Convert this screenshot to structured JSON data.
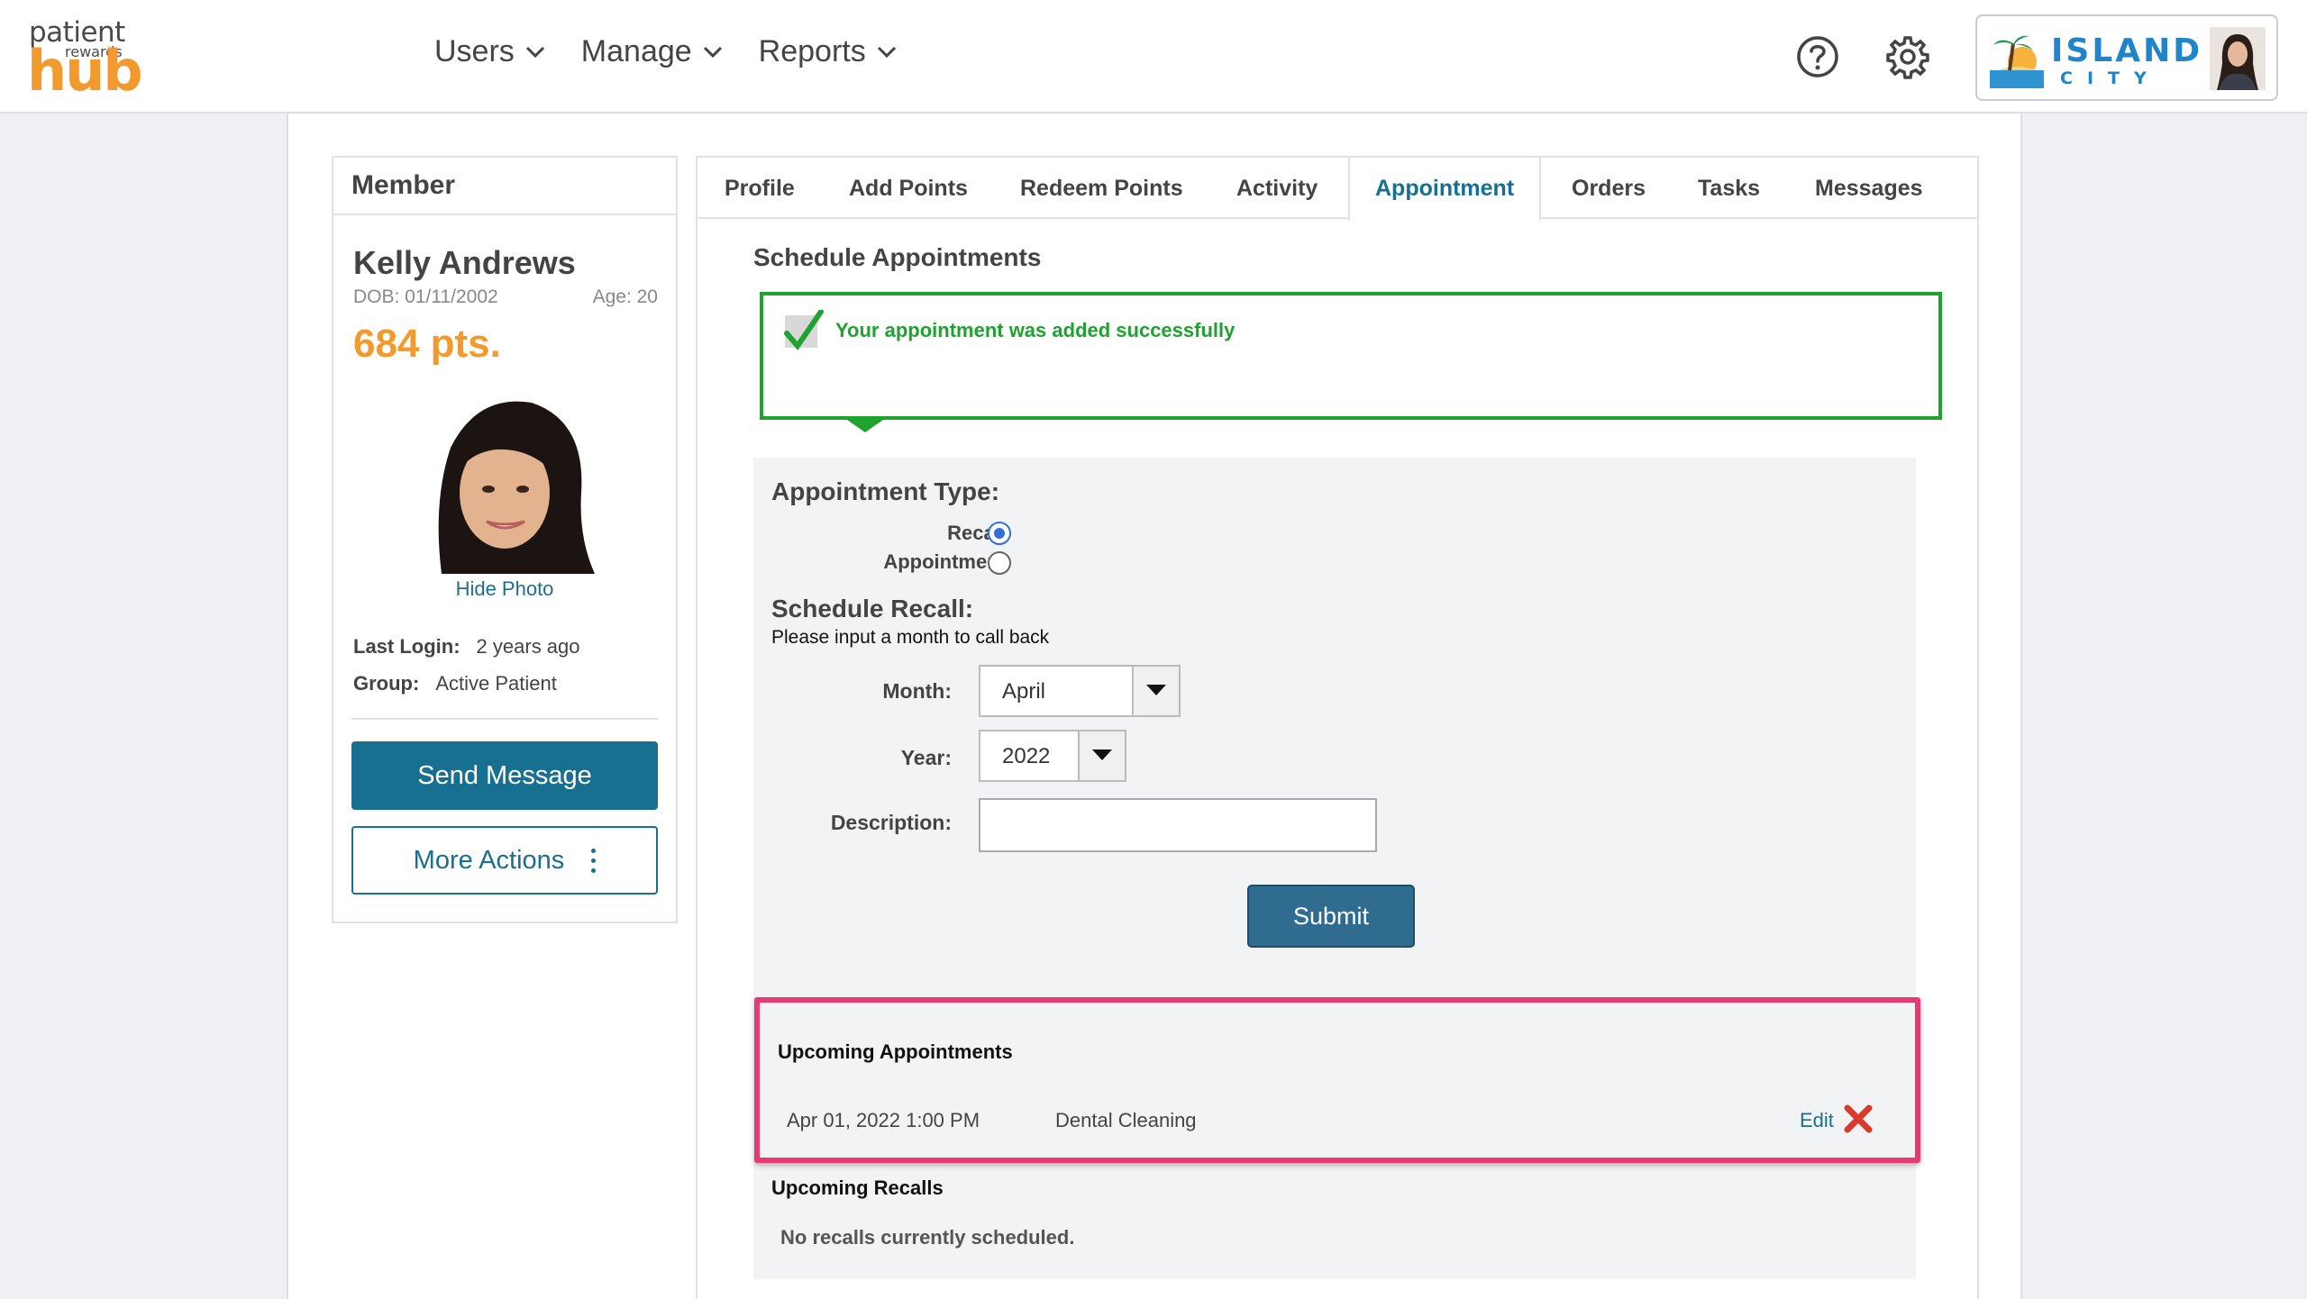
{
  "header": {
    "logo": {
      "line1": "patient",
      "line2": "rewards",
      "line3": "hub"
    },
    "nav": [
      {
        "label": "Users"
      },
      {
        "label": "Manage"
      },
      {
        "label": "Reports"
      }
    ],
    "icons": [
      "help-icon",
      "gear-icon"
    ],
    "account": {
      "brand_top": "ISLAND",
      "brand_bottom": "CITY"
    }
  },
  "member": {
    "card_title": "Member",
    "name": "Kelly Andrews",
    "dob": "DOB: 01/11/2002",
    "age": "Age:  20",
    "points": "684 pts.",
    "hide_photo": "Hide Photo",
    "last_login_label": "Last Login:",
    "last_login_value": "2 years ago",
    "group_label": "Group:",
    "group_value": "Active Patient",
    "send_message": "Send Message",
    "more_actions": "More Actions"
  },
  "tabs": [
    {
      "label": "Profile"
    },
    {
      "label": "Add Points"
    },
    {
      "label": "Redeem Points"
    },
    {
      "label": "Activity"
    },
    {
      "label": "Appointment",
      "active": true
    },
    {
      "label": "Orders"
    },
    {
      "label": "Tasks"
    },
    {
      "label": "Messages"
    }
  ],
  "schedule": {
    "title": "Schedule Appointments",
    "success_message": "Your appointment was added successfully",
    "appointment_type_label": "Appointment Type:",
    "type_options": [
      {
        "label": "Recall",
        "selected": true
      },
      {
        "label": "Appointment",
        "selected": false
      }
    ],
    "schedule_recall_label": "Schedule Recall:",
    "hint": "Please input a month to call back",
    "month_label": "Month:",
    "month_value": "April",
    "year_label": "Year:",
    "year_value": "2022",
    "description_label": "Description:",
    "description_value": "",
    "submit_label": "Submit"
  },
  "upcoming_appointments": {
    "title": "Upcoming Appointments",
    "items": [
      {
        "datetime": "Apr 01, 2022 1:00 PM",
        "description": "Dental Cleaning",
        "edit_label": "Edit"
      }
    ]
  },
  "upcoming_recalls": {
    "title": "Upcoming Recalls",
    "empty_message": "No recalls currently scheduled."
  },
  "colors": {
    "accent": "#17708f",
    "points": "#f39a2e",
    "success": "#1fa230",
    "highlight": "#e83a72"
  }
}
